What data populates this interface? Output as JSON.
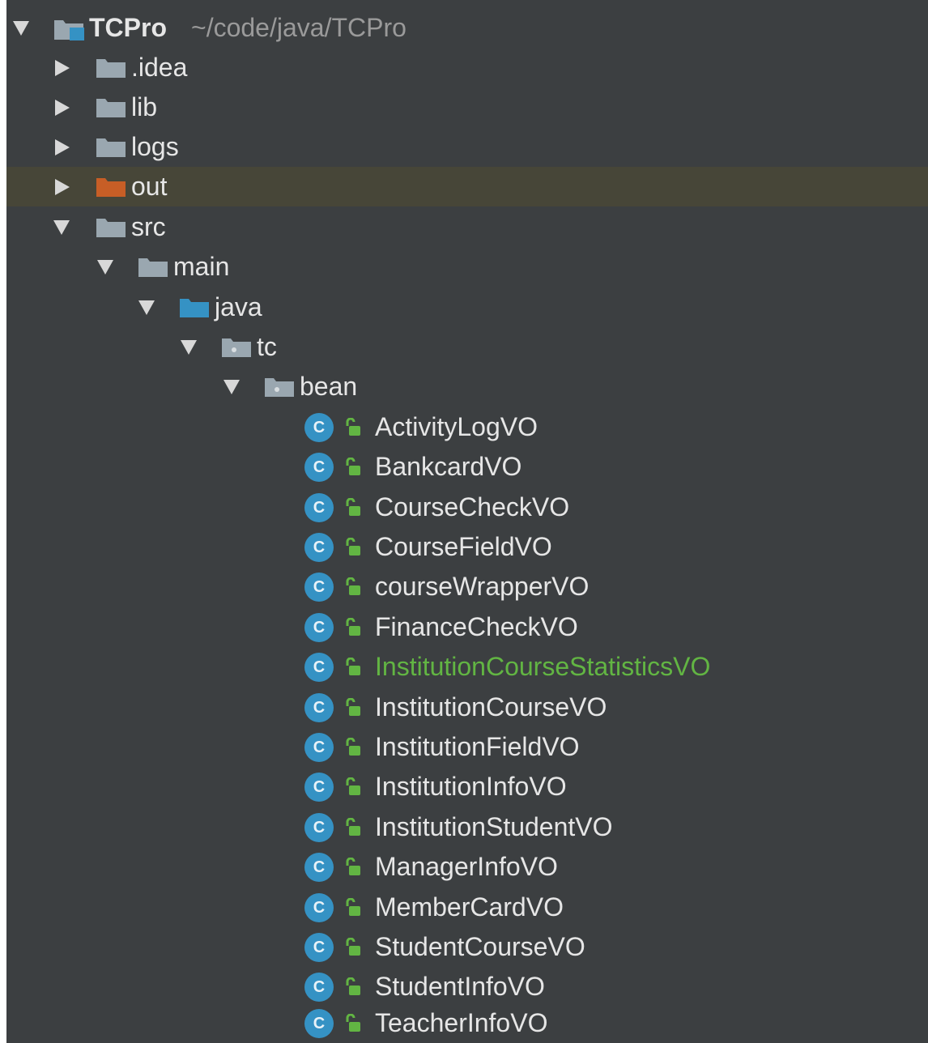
{
  "project": {
    "name": "TCPro",
    "path": "~/code/java/TCPro"
  },
  "folders": {
    "idea": ".idea",
    "lib": "lib",
    "logs": "logs",
    "out": "out",
    "src": "src",
    "main": "main",
    "java": "java",
    "tc": "tc",
    "bean": "bean"
  },
  "classes": [
    "ActivityLogVO",
    "BankcardVO",
    "CourseCheckVO",
    "CourseFieldVO",
    "courseWrapperVO",
    "FinanceCheckVO",
    "InstitutionCourseStatisticsVO",
    "InstitutionCourseVO",
    "InstitutionFieldVO",
    "InstitutionInfoVO",
    "InstitutionStudentVO",
    "ManagerInfoVO",
    "MemberCardVO",
    "StudentCourseVO",
    "StudentInfoVO",
    "TeacherInfoVO"
  ],
  "class_icon_letter": "C",
  "colors": {
    "background": "#3c3f41",
    "highlight_row": "#474638",
    "folder_gray": "#9aa7b0",
    "folder_excluded": "#c75e26",
    "folder_source": "#3592c4",
    "class_icon": "#3592c4",
    "modified_text": "#62b543",
    "access_icon": "#62b543"
  }
}
